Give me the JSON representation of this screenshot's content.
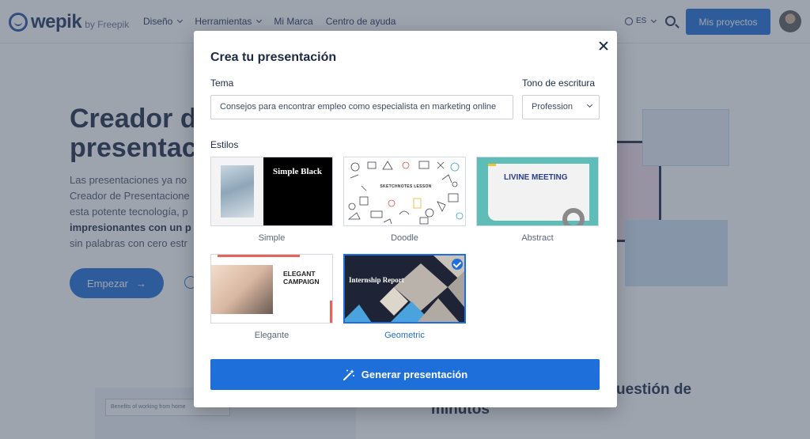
{
  "header": {
    "logo_text": "wepik",
    "logo_by": "by Freepik",
    "nav": [
      "Diseño",
      "Herramientas",
      "Mi Marca",
      "Centro de ayuda"
    ],
    "language": "ES",
    "projects_button": "Mis proyectos"
  },
  "hero": {
    "title_line1": "Creador de",
    "title_line2": "presentaci",
    "text_line1": "Las presentaciones ya no",
    "text_line2": "Creador de Presentacione",
    "text_line3": "esta potente tecnología, p",
    "text_bold": "impresionantes con un p",
    "text_line5": "sin palabras con cero estr",
    "start_button": "Empezar",
    "section_line1": "en cuestión de",
    "section_line2": "minutos",
    "mock_input": "Benefits of working from home"
  },
  "modal": {
    "title": "Crea tu presentación",
    "topic_label": "Tema",
    "topic_value": "Consejos para encontrar empleo como especialista en marketing online",
    "tone_label": "Tono de escritura",
    "tone_value": "Profession",
    "styles_label": "Estilos",
    "styles": [
      {
        "name": "Simple",
        "thumb_text": "Simple Black",
        "selected": false
      },
      {
        "name": "Doodle",
        "thumb_text": "SKETCHNOTES LESSON",
        "selected": false
      },
      {
        "name": "Abstract",
        "thumb_text": "LIVINE MEETING",
        "selected": false
      },
      {
        "name": "Elegante",
        "thumb_text": "ELEGANT\nCAMPAIGN",
        "selected": false
      },
      {
        "name": "Geometric",
        "thumb_text": "Internship Report",
        "selected": true
      }
    ],
    "generate_button": "Generar presentación"
  },
  "colors": {
    "accent": "#1e6fd9",
    "overlay": "#3e4a5e"
  }
}
